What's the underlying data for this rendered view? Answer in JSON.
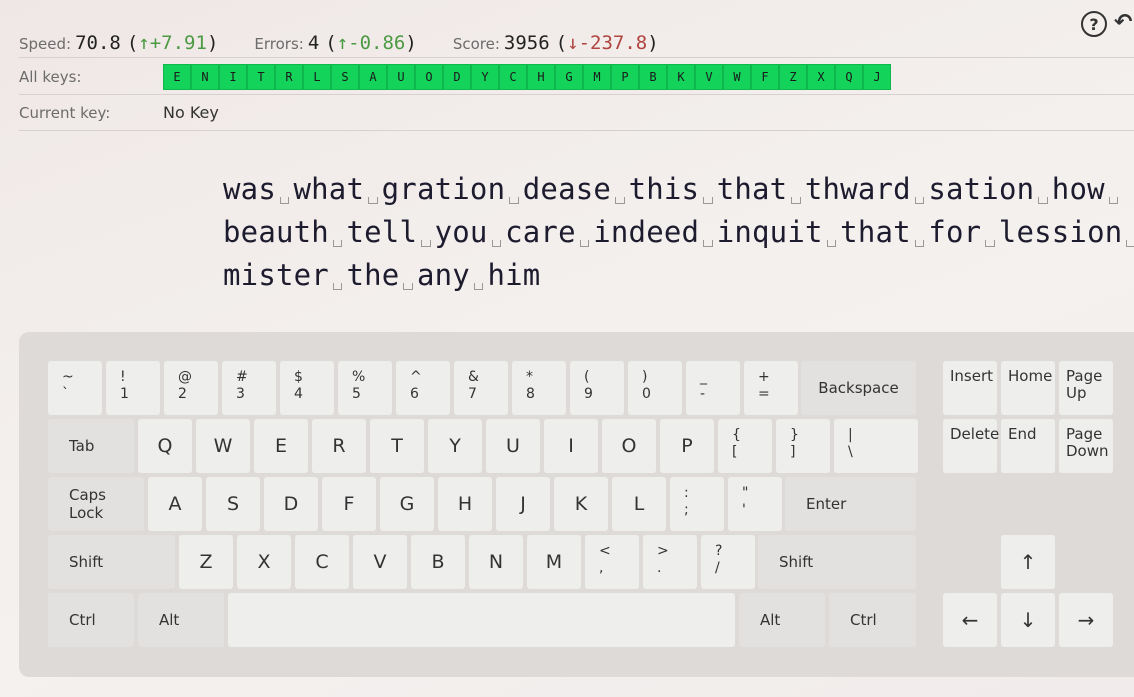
{
  "stats": {
    "speed": {
      "label": "Speed:",
      "value": "70.8",
      "open": "(",
      "delta": "↑+7.91",
      "close": ")"
    },
    "errors": {
      "label": "Errors:",
      "value": "4",
      "open": "(",
      "delta": "↑-0.86",
      "close": ")"
    },
    "score": {
      "label": "Score:",
      "value": "3956",
      "open": "(",
      "delta": "↓-237.8",
      "close": ")"
    }
  },
  "toolbar": {
    "help_icon": "?",
    "undo_icon": "↶"
  },
  "all_keys": {
    "label": "All keys:",
    "keys": [
      "E",
      "N",
      "I",
      "T",
      "R",
      "L",
      "S",
      "A",
      "U",
      "O",
      "D",
      "Y",
      "C",
      "H",
      "G",
      "M",
      "P",
      "B",
      "K",
      "V",
      "W",
      "F",
      "Z",
      "X",
      "Q",
      "J"
    ],
    "chip_color": "#14d35b"
  },
  "current_key": {
    "label": "Current key:",
    "value": "No Key"
  },
  "practice_text": {
    "lines": [
      [
        "was",
        "what",
        "gration",
        "dease",
        "this",
        "that",
        "thward",
        "sation",
        "how"
      ],
      [
        "beauth",
        "tell",
        "you",
        "care",
        "indeed",
        "inquit",
        "that",
        "for",
        "lession"
      ],
      [
        "mister",
        "the",
        "any",
        "him"
      ]
    ]
  },
  "keyboard": {
    "row1": [
      {
        "top": "~",
        "bottom": "`"
      },
      {
        "top": "!",
        "bottom": "1"
      },
      {
        "top": "@",
        "bottom": "2"
      },
      {
        "top": "#",
        "bottom": "3"
      },
      {
        "top": "$",
        "bottom": "4"
      },
      {
        "top": "%",
        "bottom": "5"
      },
      {
        "top": "^",
        "bottom": "6"
      },
      {
        "top": "&",
        "bottom": "7"
      },
      {
        "top": "*",
        "bottom": "8"
      },
      {
        "top": "(",
        "bottom": "9"
      },
      {
        "top": ")",
        "bottom": "0"
      },
      {
        "top": "_",
        "bottom": "-"
      },
      {
        "top": "+",
        "bottom": "="
      }
    ],
    "backspace": "Backspace",
    "tab": "Tab",
    "row2": [
      "Q",
      "W",
      "E",
      "R",
      "T",
      "Y",
      "U",
      "I",
      "O",
      "P"
    ],
    "row2_sym": [
      {
        "top": "{",
        "bottom": "["
      },
      {
        "top": "}",
        "bottom": "]"
      },
      {
        "top": "|",
        "bottom": "\\"
      }
    ],
    "caps": "Caps Lock",
    "row3": [
      "A",
      "S",
      "D",
      "F",
      "G",
      "H",
      "J",
      "K",
      "L"
    ],
    "row3_sym": [
      {
        "top": ":",
        "bottom": ";"
      },
      {
        "top": "\"",
        "bottom": "'"
      }
    ],
    "enter": "Enter",
    "shift_left": "Shift",
    "row4": [
      "Z",
      "X",
      "C",
      "V",
      "B",
      "N",
      "M"
    ],
    "row4_sym": [
      {
        "top": "<",
        "bottom": ","
      },
      {
        "top": ">",
        "bottom": "."
      },
      {
        "top": "?",
        "bottom": "/"
      }
    ],
    "shift_right": "Shift",
    "ctrl_left": "Ctrl",
    "alt_left": "Alt",
    "alt_right": "Alt",
    "ctrl_right": "Ctrl",
    "nav": {
      "insert": "Insert",
      "home": "Home",
      "page_up": "Page Up",
      "delete": "Delete",
      "end": "End",
      "page_down": "Page Down"
    },
    "arrows": {
      "up": "↑",
      "left": "←",
      "down": "↓",
      "right": "→"
    }
  }
}
